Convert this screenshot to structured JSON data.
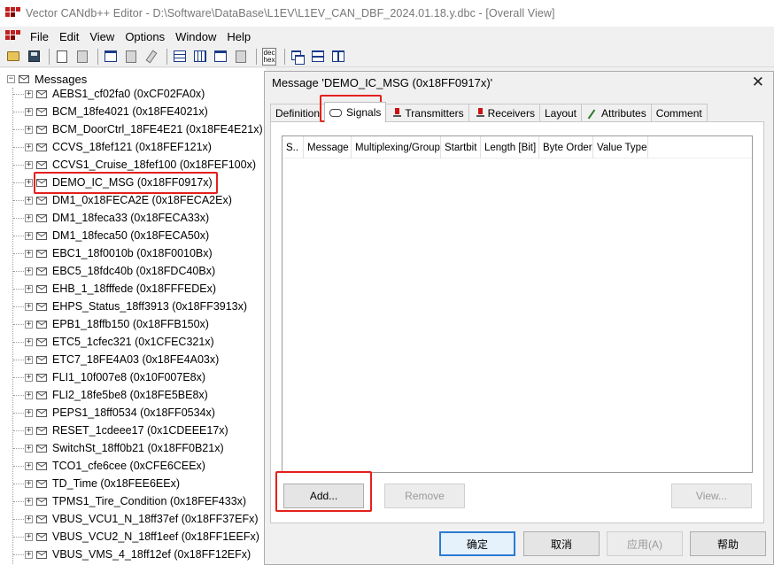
{
  "window": {
    "title": "Vector CANdb++ Editor - D:\\Software\\DataBase\\L1EV\\L1EV_CAN_DBF_2024.01.18.y.dbc - [Overall View]",
    "app_icon": "vector-logo-icon"
  },
  "menu": [
    "File",
    "Edit",
    "View",
    "Options",
    "Window",
    "Help"
  ],
  "toolbar": {
    "dechex_label": "dec\nhex",
    "icons": [
      "open-folder-icon",
      "save-icon",
      "copy-icon",
      "paste-icon",
      "properties-icon",
      "disabled-icon",
      "tool-icon",
      "table-icon",
      "grid-icon",
      "window-icon",
      "view-icon",
      "dec-hex-icon",
      "cascade-icon",
      "tile-horizontal-icon",
      "tile-vertical-icon"
    ]
  },
  "tree": {
    "root_label": "Messages",
    "items": [
      "AEBS1_cf02fa0 (0xCF02FA0x)",
      "BCM_18fe4021 (0x18FE4021x)",
      "BCM_DoorCtrl_18FE4E21 (0x18FE4E21x)",
      "CCVS_18fef121 (0x18FEF121x)",
      "CCVS1_Cruise_18fef100 (0x18FEF100x)",
      "DEMO_IC_MSG (0x18FF0917x)",
      "DM1_0x18FECA2E (0x18FECA2Ex)",
      "DM1_18feca33 (0x18FECA33x)",
      "DM1_18feca50 (0x18FECA50x)",
      "EBC1_18f0010b (0x18F0010Bx)",
      "EBC5_18fdc40b (0x18FDC40Bx)",
      "EHB_1_18fffede (0x18FFFEDEx)",
      "EHPS_Status_18ff3913 (0x18FF3913x)",
      "EPB1_18ffb150 (0x18FFB150x)",
      "ETC5_1cfec321 (0x1CFEC321x)",
      "ETC7_18FE4A03 (0x18FE4A03x)",
      "FLI1_10f007e8 (0x10F007E8x)",
      "FLI2_18fe5be8 (0x18FE5BE8x)",
      "PEPS1_18ff0534 (0x18FF0534x)",
      "RESET_1cdeee17 (0x1CDEEE17x)",
      "SwitchSt_18ff0b21 (0x18FF0B21x)",
      "TCO1_cfe6cee (0xCFE6CEEx)",
      "TD_Time (0x18FEE6EEx)",
      "TPMS1_Tire_Condition (0x18FEF433x)",
      "VBUS_VCU1_N_18ff37ef (0x18FF37EFx)",
      "VBUS_VCU2_N_18ff1eef (0x18FF1EEFx)",
      "VBUS_VMS_4_18ff12ef (0x18FF12EFx)"
    ],
    "highlighted_item": "DEMO_IC_MSG (0x18FF0917x)"
  },
  "dialog": {
    "title": "Message 'DEMO_IC_MSG (0x18FF0917x)'",
    "close_glyph": "✕",
    "tabs": [
      {
        "label": "Definition",
        "icon": ""
      },
      {
        "label": "Signals",
        "icon": "signal-icon",
        "active": true
      },
      {
        "label": "Transmitters",
        "icon": "pin-icon"
      },
      {
        "label": "Receivers",
        "icon": "pin-icon"
      },
      {
        "label": "Layout",
        "icon": ""
      },
      {
        "label": "Attributes",
        "icon": "wand-icon"
      },
      {
        "label": "Comment",
        "icon": ""
      }
    ],
    "columns": [
      "S..",
      "Message",
      "Multiplexing/Group",
      "Startbit",
      "Length [Bit]",
      "Byte Order",
      "Value Type"
    ],
    "rows": [],
    "buttons": {
      "add": "Add...",
      "remove": "Remove",
      "view": "View...",
      "ok": "确定",
      "cancel": "取消",
      "apply": "应用(A)",
      "help": "帮助"
    }
  },
  "colors": {
    "highlight_box": "#e4201c",
    "focus_border": "#2a7bd4"
  }
}
